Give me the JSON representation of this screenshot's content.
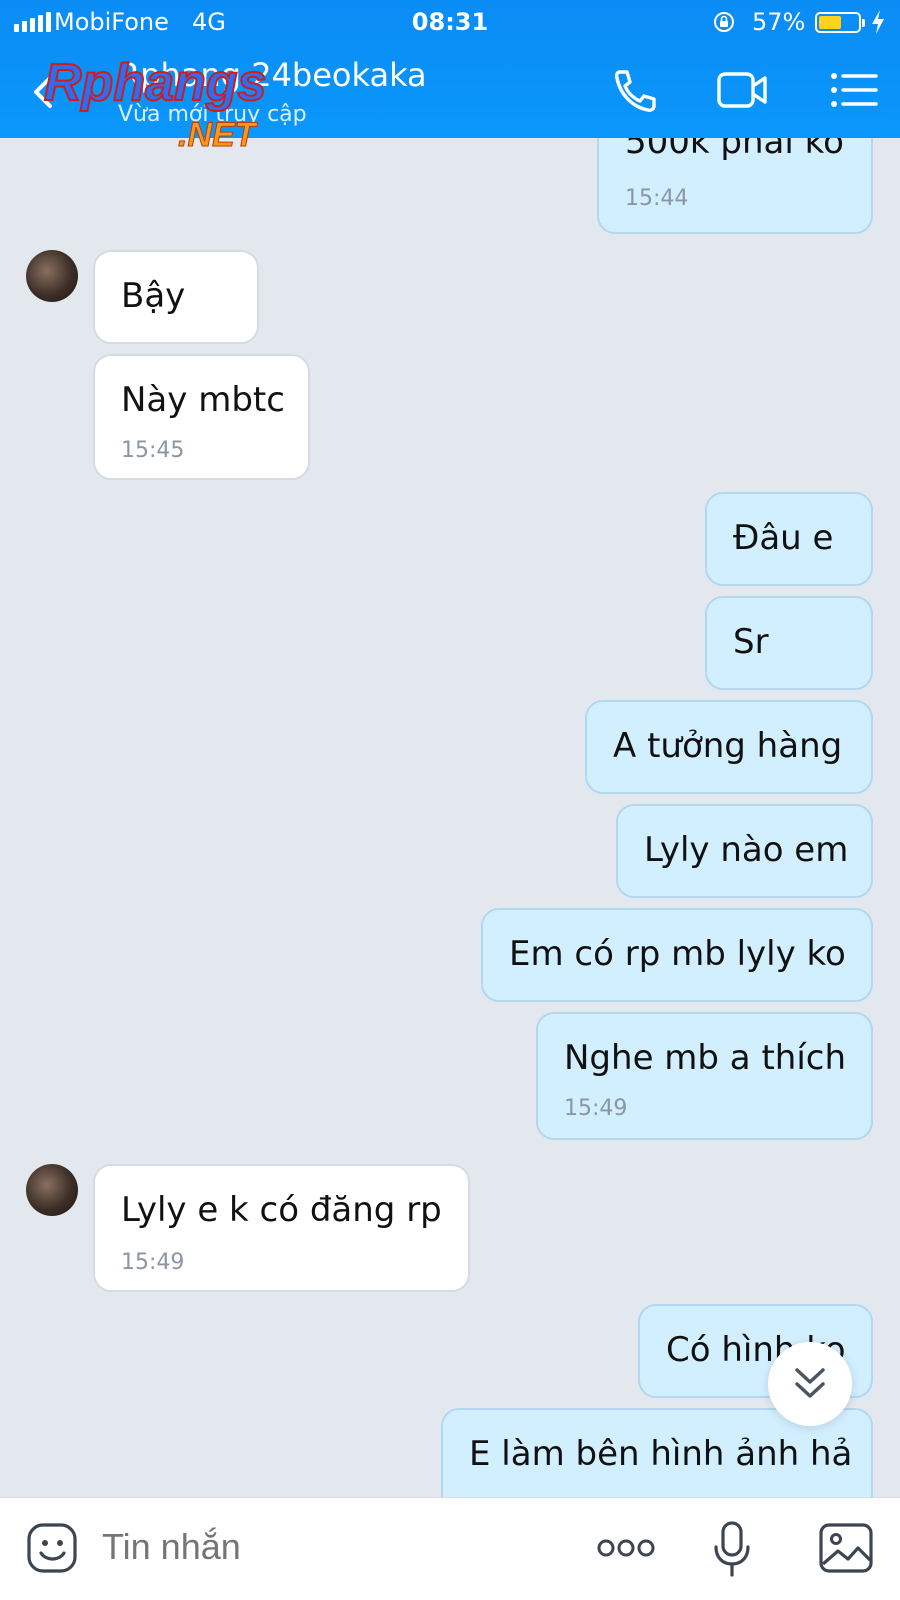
{
  "status_bar": {
    "carrier": "MobiFone",
    "network": "4G",
    "time": "08:31",
    "battery": "57%",
    "battery_level": 0.57
  },
  "header": {
    "contact_name": "Rphang.24beokaka",
    "status": "Vừa mới truy cập",
    "watermark_top": "Rphangs",
    "watermark_bottom": ".NET",
    "icons": [
      "back-icon",
      "phone-icon",
      "video-icon",
      "menu-icon"
    ]
  },
  "messages": [
    {
      "dir": "out",
      "text": "500k phải ko",
      "time": "15:44"
    },
    {
      "dir": "in",
      "text": "Bậy",
      "time": ""
    },
    {
      "dir": "in",
      "text": "Này mbtc",
      "time": "15:45"
    },
    {
      "dir": "out",
      "text": "Đâu e",
      "time": ""
    },
    {
      "dir": "out",
      "text": "Sr",
      "time": ""
    },
    {
      "dir": "out",
      "text": "A tưởng hàng",
      "time": ""
    },
    {
      "dir": "out",
      "text": "Lyly nào em",
      "time": ""
    },
    {
      "dir": "out",
      "text": "Em có rp mb lyly ko",
      "time": ""
    },
    {
      "dir": "out",
      "text": "Nghe mb a thích",
      "time": "15:49"
    },
    {
      "dir": "in",
      "text": "Lyly e k có đăng rp",
      "time": "15:49"
    },
    {
      "dir": "out",
      "text": "Có hình ko",
      "time": ""
    },
    {
      "dir": "out",
      "text": "E làm bên hình ảnh hả",
      "time": ""
    }
  ],
  "composer": {
    "placeholder": "Tin nhắn",
    "icons": [
      "emoji-icon",
      "more-icon",
      "mic-icon",
      "image-icon"
    ]
  },
  "colors": {
    "header": "#0a97fb",
    "outgoing_bubble": "#d2efff",
    "incoming_bubble": "#ffffff",
    "chat_background": "#e3e8ef"
  }
}
